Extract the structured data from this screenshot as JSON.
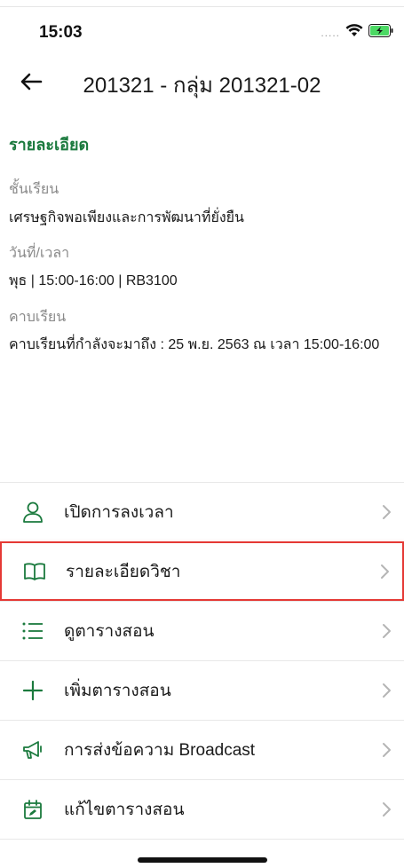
{
  "status_bar": {
    "time": "15:03",
    "signal": "....."
  },
  "header": {
    "title": "201321 - กลุ่ม 201321-02"
  },
  "details": {
    "section_title": "รายละเอียด",
    "fields": [
      {
        "label": "ชั้นเรียน",
        "value": "เศรษฐกิจพอเพียงและการพัฒนาที่ยั่งยืน"
      },
      {
        "label": "วันที่/เวลา",
        "value": "พุธ  |  15:00-16:00  |  RB3100"
      },
      {
        "label": "คาบเรียน",
        "value": "คาบเรียนที่กำลังจะมาถึง : 25 พ.ย. 2563 ณ เวลา 15:00-16:00"
      }
    ]
  },
  "menu": {
    "items": [
      {
        "label": "เปิดการลงเวลา",
        "icon": "person-icon"
      },
      {
        "label": "รายละเอียดวิชา",
        "icon": "book-icon"
      },
      {
        "label": "ดูตารางสอน",
        "icon": "list-icon"
      },
      {
        "label": "เพิ่มตารางสอน",
        "icon": "plus-icon"
      },
      {
        "label": "การส่งข้อความ Broadcast",
        "icon": "megaphone-icon"
      },
      {
        "label": "แก้ไขตารางสอน",
        "icon": "calendar-edit-icon"
      }
    ]
  },
  "colors": {
    "accent": "#1b7a3e",
    "highlight": "#e53935",
    "battery": "#4cd964"
  }
}
